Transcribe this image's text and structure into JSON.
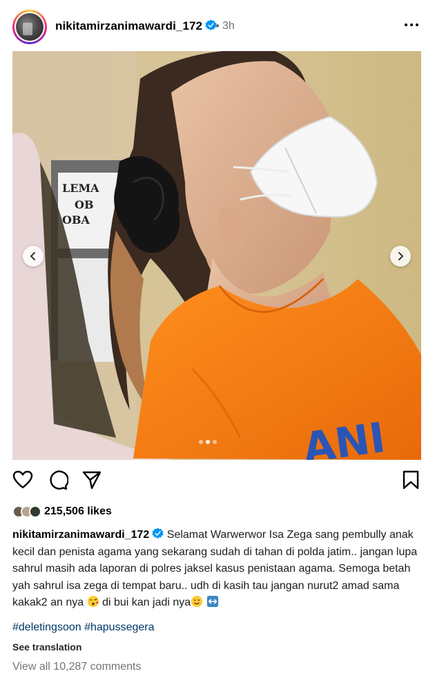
{
  "post": {
    "username": "nikitamirzanimawardi_172",
    "separator": "•",
    "time": "3h"
  },
  "media": {
    "carousel_count": 3,
    "carousel_active_index": 1,
    "sign_text_1": "LEMA",
    "sign_text_2": "OB",
    "sign_text_3": "OBA",
    "shirt_text": "ANI"
  },
  "likes": {
    "count_text": "215,506 likes"
  },
  "caption": {
    "username": "nikitamirzanimawardi_172",
    "text": "Selamat Warwerwor Isa Zega sang pembully anak kecil dan penista agama yang sekarang sudah di tahan di polda jatim.. jangan lupa sahrul masih ada laporan di polres jaksel kasus penistaan agama. Semoga betah yah sahrul isa zega di tempat baru.. udh di kasih tau jangan nurut2 amad sama kakak2 an nya",
    "text_after_emoji": " di bui kan jadi nya"
  },
  "hashtags": "#deletingsoon #hapussegera",
  "see_translation": "See translation",
  "view_comments": "View all 10,287 comments",
  "colors": {
    "verified": "#0095f6",
    "hashtag": "#00376b",
    "muted": "#737373",
    "shirt": "#f57f17"
  }
}
